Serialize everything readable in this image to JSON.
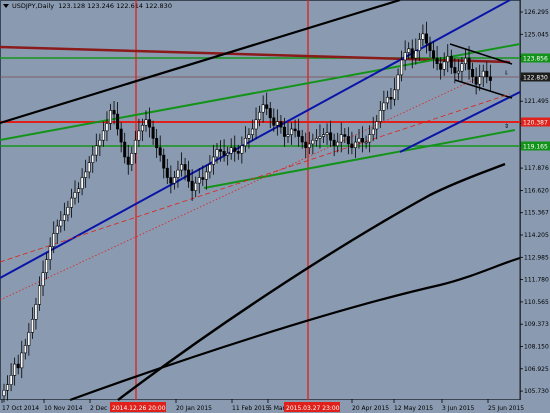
{
  "window": {
    "symbol": "USDJPY",
    "timeframe": "Daily",
    "ohlc": "123.128 123.246 122.614 122.830"
  },
  "colors": {
    "background": "#8a9bb1",
    "bull": "#000000",
    "bear": "#000000",
    "accent_red": "#e0201a",
    "accent_green": "#14931a",
    "accent_blue": "#0a14a8",
    "price_tag_bg": "#1d1d1d"
  },
  "price_axis": {
    "ticks": [
      "126.295",
      "125.045",
      "123.856",
      "122.830",
      "121.495",
      "120.387",
      "119.185",
      "117.876",
      "116.620",
      "115.367",
      "114.205",
      "112.985",
      "111.780",
      "110.565",
      "109.373",
      "108.150",
      "106.925",
      "105.730"
    ]
  },
  "price_tags": [
    {
      "label": "123.856",
      "color": "#14931a"
    },
    {
      "label": "122.830",
      "color": "#1d1d1d"
    },
    {
      "label": "120.387",
      "color": "#e0201a"
    },
    {
      "label": "119.165",
      "color": "#14931a"
    }
  ],
  "time_axis": {
    "labels": [
      "17 Oct 2014",
      "10 Nov 2014",
      "2 Dec",
      "20 Jan 2015",
      "11 Feb 2015",
      "5 Mar",
      "20 Apr 2015",
      "12 May 2015",
      "3 Jun 2015",
      "25 Jun 2015"
    ],
    "highlight_labels": [
      "2014.12.26 20:00",
      "2015.03.27 23:00"
    ]
  },
  "chart_data": {
    "type": "candlestick",
    "series": [
      {
        "values": [
          106.2,
          106.5,
          107.0,
          107.6,
          107.4,
          108.2,
          108.6,
          109.3,
          110.0,
          110.8,
          111.8,
          112.5,
          113.2,
          113.9,
          114.6,
          115.0,
          115.3,
          115.6,
          116.0,
          116.5,
          116.8,
          117.0,
          117.6,
          117.9,
          118.4,
          118.8,
          119.3,
          119.6,
          120.1,
          120.5,
          121.2,
          121.0,
          120.2,
          119.5,
          118.7,
          118.3,
          118.9,
          119.6,
          120.1,
          120.4,
          120.7,
          120.3,
          119.7,
          119.2,
          118.8,
          118.1,
          117.6,
          117.3,
          117.6,
          118.0,
          118.3,
          118.0,
          117.4,
          116.9,
          117.3,
          117.6,
          117.5,
          117.9,
          118.3,
          118.7,
          119.1,
          119.0,
          118.8,
          118.9,
          119.2,
          119.0,
          118.9,
          119.3,
          119.7,
          119.9,
          120.2,
          120.7,
          121.1,
          121.5,
          121.3,
          120.8,
          120.4,
          120.6,
          120.3,
          119.8,
          119.9,
          120.2,
          120.1,
          119.8,
          119.5,
          119.2,
          119.4,
          119.6,
          119.7,
          119.8,
          119.9,
          120.0,
          119.6,
          119.3,
          119.5,
          119.9,
          119.8,
          119.4,
          119.2,
          119.5,
          119.7,
          119.5,
          119.5,
          119.9,
          120.2,
          120.6,
          121.2,
          121.6,
          121.9,
          121.8,
          122.3,
          123.1,
          123.9,
          124.3,
          124.5,
          124.0,
          124.4,
          125.0,
          125.3,
          124.8,
          124.4,
          124.0,
          123.7,
          123.4,
          123.8,
          124.1,
          123.5,
          123.2,
          123.3,
          123.7,
          124.0,
          123.4,
          123.0,
          122.6,
          123.0,
          123.3,
          123.0,
          122.8
        ]
      }
    ],
    "price_range": [
      105.73,
      126.9
    ]
  }
}
